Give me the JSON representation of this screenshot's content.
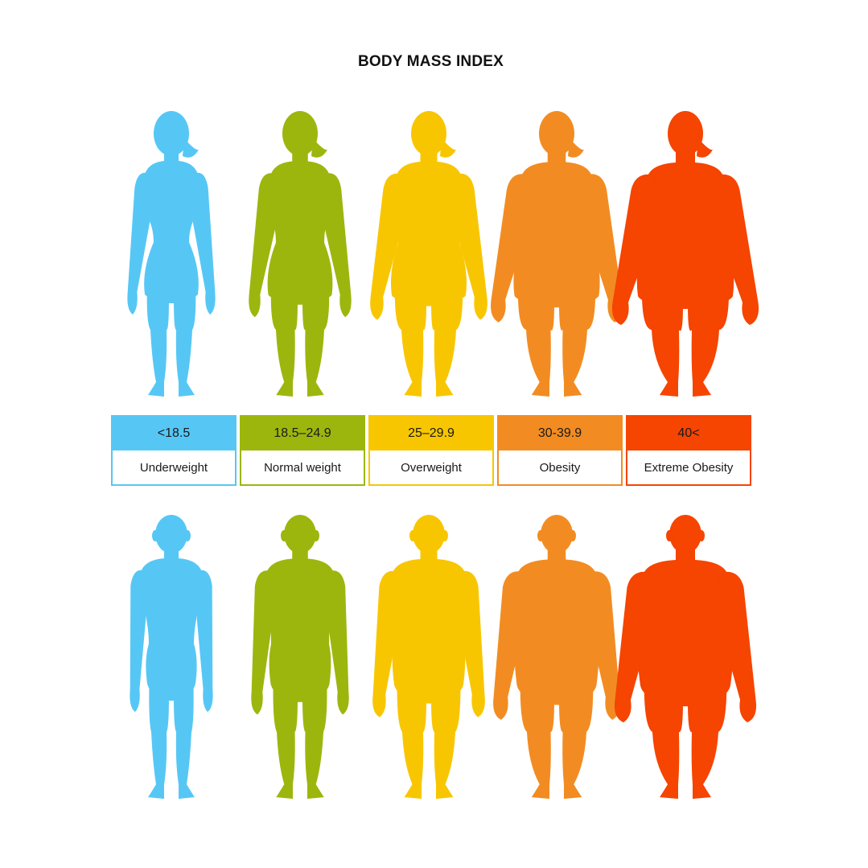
{
  "title": "BODY MASS INDEX",
  "categories": [
    {
      "range": "<18.5",
      "label": "Underweight",
      "color": "#56c7f5",
      "build": 0.0
    },
    {
      "range": "18.5–24.9",
      "label": "Normal weight",
      "color": "#9db60e",
      "build": 0.25
    },
    {
      "range": "25–29.9",
      "label": "Overweight",
      "color": "#f8c600",
      "build": 0.5
    },
    {
      "range": "30-39.9",
      "label": "Obesity",
      "color": "#f28c22",
      "build": 0.75
    },
    {
      "range": "40<",
      "label": "Extreme Obesity",
      "color": "#f64401",
      "build": 1.0
    }
  ],
  "figures": {
    "top_row": "female-silhouette-icon",
    "bottom_row": "male-silhouette-icon"
  }
}
